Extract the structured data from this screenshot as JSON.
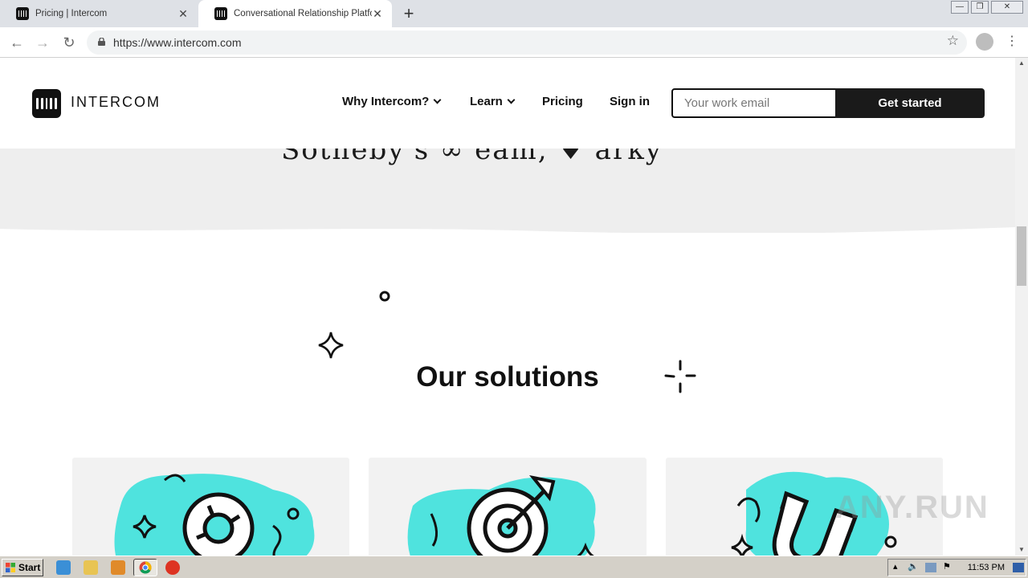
{
  "browser": {
    "tabs": [
      {
        "title": "Pricing | Intercom",
        "active": false
      },
      {
        "title": "Conversational Relationship Platform",
        "active": true
      }
    ],
    "new_tab": "+",
    "close_glyph": "✕",
    "url": "https://www.intercom.com",
    "icons": {
      "back": "←",
      "forward": "→",
      "reload": "↻",
      "bookmark": "☆",
      "menu": "⋮"
    }
  },
  "site": {
    "logo_text": "INTERCOM",
    "nav": {
      "why": "Why Intercom?",
      "learn": "Learn",
      "pricing": "Pricing",
      "signin": "Sign in"
    },
    "email_placeholder": "Your work email",
    "cta_label": "Get started",
    "customer_logos_text": "Sotheby's  ∞ eam,  ♦ arky",
    "section_title": "Our solutions"
  },
  "watermark": "ANY.RUN",
  "taskbar": {
    "start_label": "Start",
    "clock": "11:53 PM"
  },
  "colors": {
    "accent_teal": "#4fe3de",
    "dark": "#1a1a1a",
    "band_gray": "#eeeeee",
    "card_gray": "#f2f2f2"
  }
}
